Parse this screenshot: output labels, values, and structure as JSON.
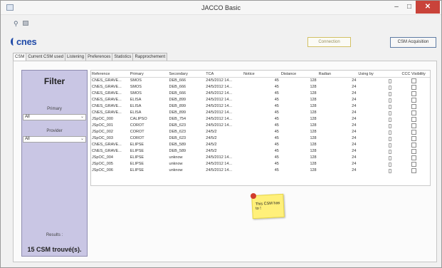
{
  "window": {
    "title": "JACCO Basic"
  },
  "logo": {
    "text": "cnes"
  },
  "buttons": {
    "connection": "Connection",
    "acquisition": "CSM Acquisition"
  },
  "tabs": [
    "CSM",
    "Current CSM used",
    "Listening",
    "Preferences",
    "Statistics",
    "Rapprochement"
  ],
  "filter": {
    "title": "Filter",
    "primary_label": "Primary",
    "primary_value": "All",
    "provider_label": "Provider",
    "provider_value": "All",
    "results_label": "Results :",
    "results_value": "15 CSM trouvé(s)."
  },
  "table": {
    "columns": [
      "Reference",
      "Primary",
      "Secondary",
      "TCA",
      "Notice",
      "Distance",
      "Radian",
      "Using by",
      "CCC Visibility"
    ],
    "rows": [
      [
        "CNES_GRAVE...",
        "SMOS",
        "DEB_666",
        "24/5/2012 14...",
        "45",
        "128",
        "24"
      ],
      [
        "CNES_GRAVE...",
        "SMOS",
        "DEB_666",
        "24/5/2012 14...",
        "45",
        "128",
        "24"
      ],
      [
        "CNES_GRAVE...",
        "SMOS",
        "DEB_666",
        "24/5/2012 14...",
        "45",
        "128",
        "24"
      ],
      [
        "CNES_GRAVE...",
        "ELISA",
        "DEB_899",
        "24/5/2012 14...",
        "45",
        "128",
        "24"
      ],
      [
        "CNES_GRAVE...",
        "ELISA",
        "DEB_899",
        "24/5/2012 14...",
        "45",
        "128",
        "24"
      ],
      [
        "CNES_GRAVE...",
        "ELISA",
        "DEB_899",
        "24/5/2012 14...",
        "45",
        "128",
        "24"
      ],
      [
        "JSpOC_000",
        "CALIPSO",
        "DEB_754",
        "24/5/2012 14...",
        "45",
        "128",
        "24"
      ],
      [
        "JSpOC_001",
        "COROT",
        "DEB_623",
        "24/5/2012 14...",
        "45",
        "128",
        "24"
      ],
      [
        "JSpOC_002",
        "COROT",
        "DEB_623",
        "24/5/2",
        "45",
        "128",
        "24"
      ],
      [
        "JSpOC_003",
        "COROT",
        "DEB_623",
        "24/5/2",
        "45",
        "128",
        "24"
      ],
      [
        "CNES_GRAVE...",
        "ELIPSE",
        "DEB_589",
        "24/5/2",
        "45",
        "128",
        "24"
      ],
      [
        "CNES_GRAVE...",
        "ELIPSE",
        "DEB_589",
        "24/5/2",
        "45",
        "128",
        "24"
      ],
      [
        "JSpOC_004",
        "ELIPSE",
        "unknow",
        "24/5/2012 14...",
        "45",
        "128",
        "24"
      ],
      [
        "JSpOC_005",
        "ELIPSE",
        "unknow",
        "24/5/2012 14...",
        "45",
        "128",
        "24"
      ],
      [
        "JSpOC_006",
        "ELIPSE",
        "unknow",
        "24/5/2012 14...",
        "45",
        "128",
        "24"
      ]
    ]
  },
  "sticky_note": {
    "text": "This CSM has to !"
  },
  "icons": {
    "app": "window-app-icon",
    "minimize": "minimize-icon",
    "maximize": "maximize-icon",
    "close": "close-icon"
  },
  "colors": {
    "filter_panel": "#c9c6e4",
    "close_button": "#c9433a",
    "sticky_note": "#fff07a",
    "pin": "#d13b2c",
    "logo": "#1f4aa8"
  }
}
